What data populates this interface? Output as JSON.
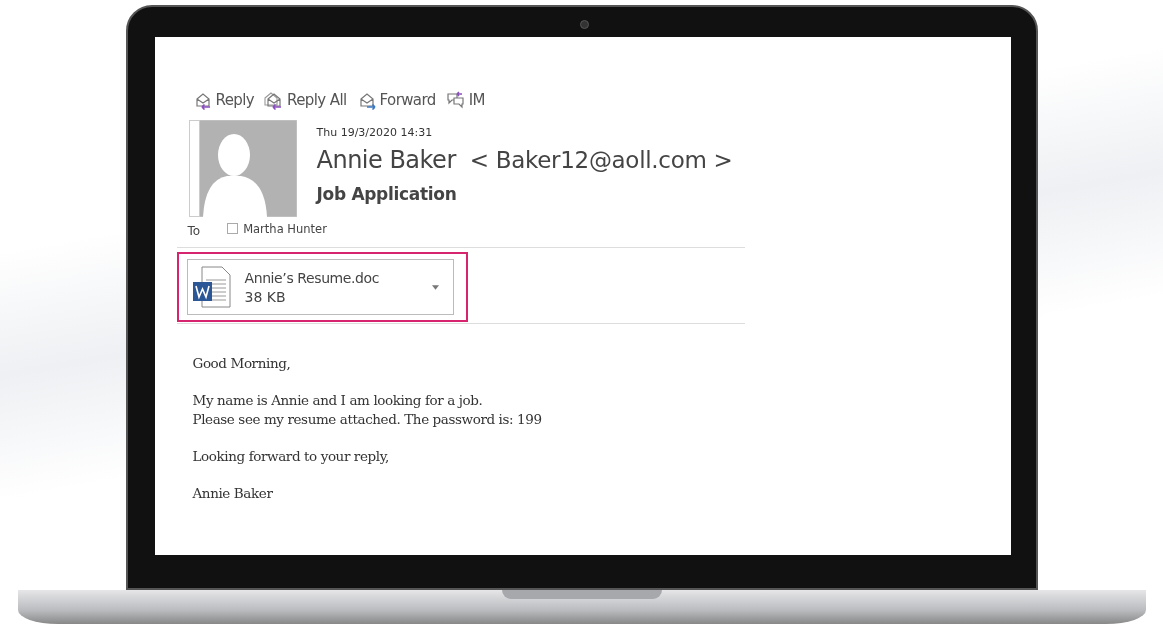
{
  "actions": [
    {
      "kind": "reply",
      "label": "Reply"
    },
    {
      "kind": "reply-all",
      "label": "Reply All"
    },
    {
      "kind": "forward",
      "label": "Forward"
    },
    {
      "kind": "im",
      "label": "IM"
    }
  ],
  "message": {
    "date": "Thu 19/3/2020 14:31",
    "sender_name": "Annie Baker",
    "sender_email": "< Baker12@aoll.com >",
    "subject": "Job Application",
    "to_label": "To",
    "recipients": [
      {
        "name": "Martha Hunter",
        "checked": false
      }
    ]
  },
  "attachments": [
    {
      "name": "Annie’s Resume.doc",
      "size": "38 KB",
      "highlighted": true
    }
  ],
  "body": [
    {
      "lines": [
        "Good Morning,"
      ]
    },
    {
      "lines": [
        "My name is Annie and I am looking for a job.",
        "Please see my resume attached. The password is: 199"
      ]
    },
    {
      "lines": [
        "Looking forward to your reply,"
      ]
    },
    {
      "lines": [
        "Annie Baker"
      ]
    }
  ]
}
